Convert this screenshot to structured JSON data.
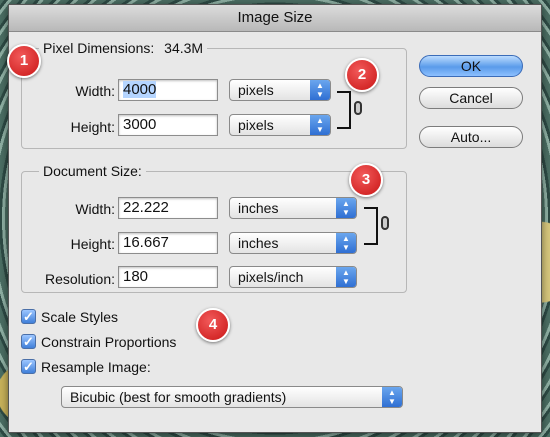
{
  "window": {
    "title": "Image Size"
  },
  "pixel_dimensions": {
    "label": "Pixel Dimensions:",
    "size": "34.3M",
    "width_label": "Width:",
    "width_value": "4000",
    "width_unit": "pixels",
    "height_label": "Height:",
    "height_value": "3000",
    "height_unit": "pixels"
  },
  "document_size": {
    "label": "Document Size:",
    "width_label": "Width:",
    "width_value": "22.222",
    "width_unit": "inches",
    "height_label": "Height:",
    "height_value": "16.667",
    "height_unit": "inches",
    "resolution_label": "Resolution:",
    "resolution_value": "180",
    "resolution_unit": "pixels/inch"
  },
  "buttons": {
    "ok": "OK",
    "cancel": "Cancel",
    "auto": "Auto..."
  },
  "options": {
    "scale_styles": "Scale Styles",
    "constrain_proportions": "Constrain Proportions",
    "resample_image": "Resample Image:",
    "resample_method": "Bicubic (best for smooth gradients)",
    "checked": true
  },
  "markers": [
    "1",
    "2",
    "3",
    "4"
  ],
  "colors": {
    "marker": "#d21f1f",
    "accent": "#3f7fd8"
  }
}
